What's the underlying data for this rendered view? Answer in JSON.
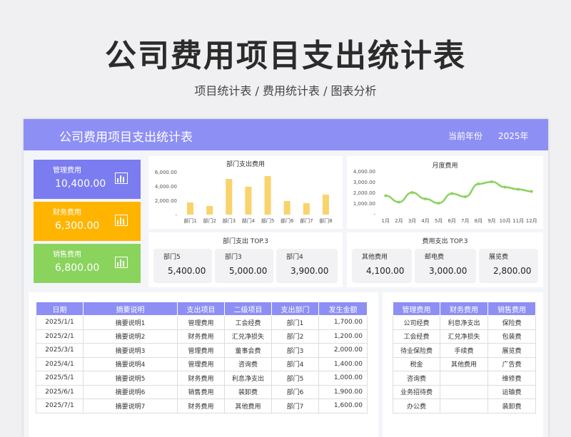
{
  "title": "公司费用项目支出统计表",
  "subtitle": "项目统计表 / 费用统计表 / 图表分析",
  "header": {
    "title": "公司费用项目支出统计表",
    "year_label": "当前年份",
    "year_value": "2025年"
  },
  "kpis": [
    {
      "label": "管理费用",
      "value": "10,400.00",
      "color": "#7a7cf0",
      "icon": "bar-chart-icon"
    },
    {
      "label": "财务费用",
      "value": "6,300.00",
      "color": "#ffb400",
      "icon": "bar-chart-icon"
    },
    {
      "label": "销售费用",
      "value": "6,800.00",
      "color": "#8ad35d",
      "icon": "bar-chart-icon"
    }
  ],
  "chart_data": [
    {
      "type": "bar",
      "title": "部门支出费用",
      "categories": [
        "部门1",
        "部门2",
        "部门3",
        "部门4",
        "部门5",
        "部门6",
        "部门7",
        "部门8"
      ],
      "values": [
        1700,
        1200,
        5000,
        3900,
        5400,
        1900,
        1600,
        2800
      ],
      "yticks": [
        "6,000.00",
        "4,000.00",
        "2,000.00",
        "-"
      ],
      "ylim": [
        0,
        6000
      ],
      "color": "#f9d36b"
    },
    {
      "type": "line",
      "title": "月度费用",
      "categories": [
        "1月",
        "2月",
        "3月",
        "4月",
        "5月",
        "6月",
        "7月",
        "8月",
        "9月",
        "10月",
        "11月",
        "12月"
      ],
      "values": [
        1700,
        1100,
        2000,
        1400,
        1000,
        1900,
        1600,
        2800,
        3000,
        2500,
        2300,
        2100
      ],
      "yticks": [
        "4,000.00",
        "3,000.00",
        "2,000.00",
        "1,000.00",
        "-"
      ],
      "ylim": [
        0,
        4000
      ],
      "color": "#8ad35d"
    }
  ],
  "dept_top3": {
    "title": "部门支出 TOP.3",
    "items": [
      {
        "label": "部门5",
        "value": "5,400.00"
      },
      {
        "label": "部门3",
        "value": "5,000.00"
      },
      {
        "label": "部门4",
        "value": "3,900.00"
      }
    ]
  },
  "fee_top3": {
    "title": "费用支出 TOP.3",
    "items": [
      {
        "label": "其他费用",
        "value": "4,100.00"
      },
      {
        "label": "邮电费",
        "value": "3,000.00"
      },
      {
        "label": "展览费",
        "value": "2,800.00"
      }
    ]
  },
  "detail_table": {
    "headers": [
      "日期",
      "摘要说明",
      "支出项目",
      "二级项目",
      "支出部门",
      "发生金额"
    ],
    "rows": [
      [
        "2025/1/1",
        "摘要说明1",
        "管理费用",
        "工会经费",
        "部门1",
        "1,700.00"
      ],
      [
        "2025/2/1",
        "摘要说明2",
        "财务费用",
        "汇兑净损失",
        "部门2",
        "1,200.00"
      ],
      [
        "2025/3/1",
        "摘要说明3",
        "管理费用",
        "董事会费",
        "部门3",
        "2,000.00"
      ],
      [
        "2025/4/1",
        "摘要说明4",
        "管理费用",
        "咨询费",
        "部门4",
        "1,400.00"
      ],
      [
        "2025/5/1",
        "摘要说明5",
        "财务费用",
        "利息净支出",
        "部门5",
        "1,000.00"
      ],
      [
        "2025/6/1",
        "摘要说明6",
        "销售费用",
        "装卸费",
        "部门6",
        "1,900.00"
      ],
      [
        "2025/7/1",
        "摘要说明7",
        "财务费用",
        "其他费用",
        "部门7",
        "1,600.00"
      ]
    ]
  },
  "category_table": {
    "headers": [
      "管理费用",
      "财务费用",
      "销售费用"
    ],
    "rows": [
      [
        "公司经费",
        "利息净支出",
        "保险费"
      ],
      [
        "工会经费",
        "汇兑净损失",
        "包装费"
      ],
      [
        "待业保险费",
        "手续费",
        "展览费"
      ],
      [
        "税金",
        "其他费用",
        "广告费"
      ],
      [
        "咨询费",
        "",
        "维修费"
      ],
      [
        "业务招待费",
        "",
        "运输费"
      ],
      [
        "办公费",
        "",
        "装卸费"
      ]
    ]
  }
}
